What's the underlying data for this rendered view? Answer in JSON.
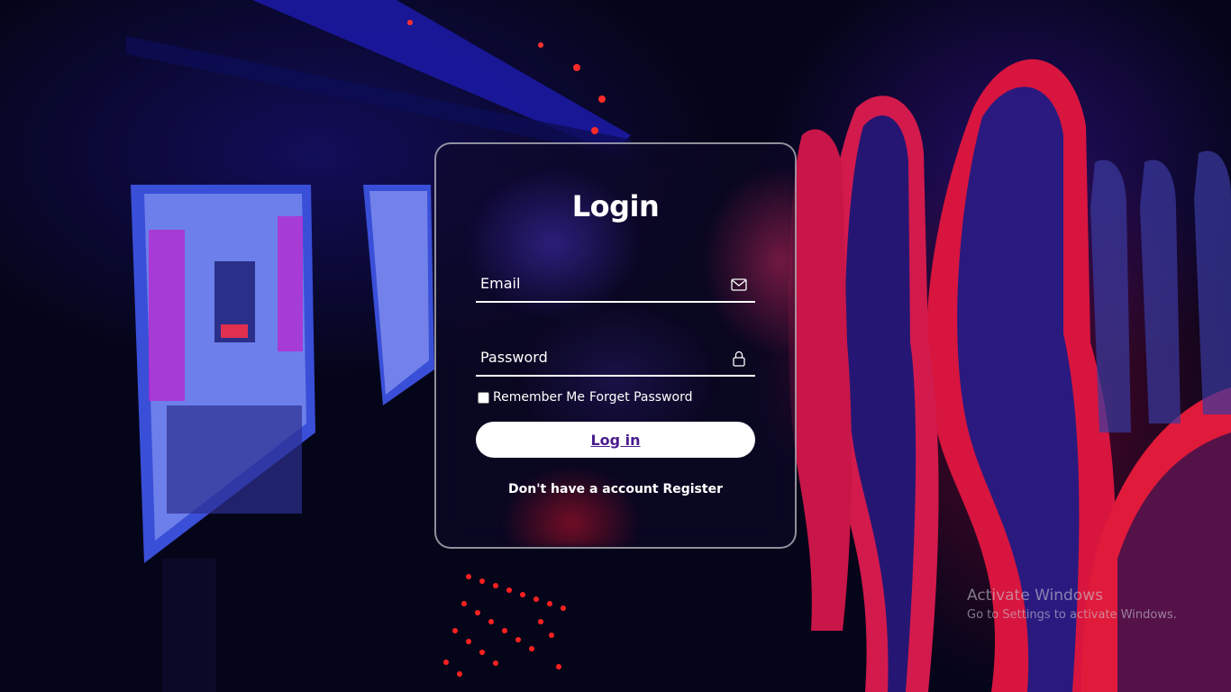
{
  "login_form": {
    "title": "Login",
    "email_placeholder": "Email",
    "password_placeholder": "Password",
    "remember_label": "Remember Me",
    "forgot_label": "Forget Password",
    "login_button": "Log in",
    "no_account_text": "Don't have a account",
    "register_link": "Register",
    "email_icon": "envelope-icon",
    "password_icon": "lock-icon"
  },
  "watermark": {
    "title": "Activate Windows",
    "subtitle": "Go to Settings to activate Windows."
  },
  "colors": {
    "button_text": "#4a1b8f",
    "accent_red": "#e0103a",
    "accent_blue": "#2a1fd6"
  }
}
